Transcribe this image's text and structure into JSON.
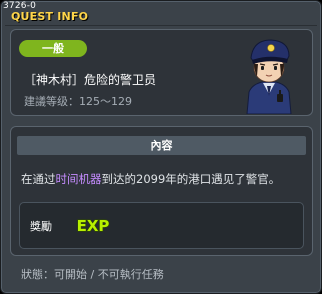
{
  "window": {
    "quest_id": "3726-0",
    "title": "QUEST INFO"
  },
  "quest": {
    "category": "一般",
    "name": "［神木村］危险的警卫员",
    "level_range": "建議等级：125～129"
  },
  "content": {
    "header": "內容",
    "description_before": "在通过",
    "description_highlight": "时间机器",
    "description_after": "到达的2099年的港口遇见了警官。"
  },
  "reward": {
    "label": "獎勵",
    "exp_text": "EXP"
  },
  "status": {
    "text": "狀態：可開始 / 不可執行任務"
  },
  "colors": {
    "title": "#ffd64a",
    "badge": "#7fb51e",
    "highlight": "#c58cff",
    "exp_fill": "#b8f000"
  },
  "icons": {
    "npc": "police-officer-npc-icon",
    "exp": "exp-icon"
  }
}
